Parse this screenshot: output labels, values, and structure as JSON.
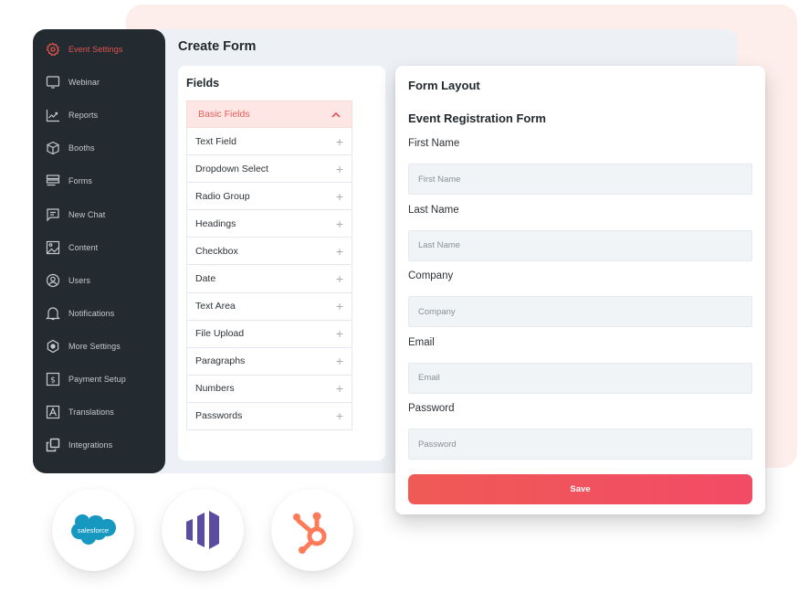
{
  "sidebar": {
    "items": [
      {
        "label": "Event Settings",
        "icon": "gear-icon",
        "active": true
      },
      {
        "label": "Webinar",
        "icon": "monitor-icon"
      },
      {
        "label": "Reports",
        "icon": "chart-icon"
      },
      {
        "label": "Booths",
        "icon": "cube-icon"
      },
      {
        "label": "Forms",
        "icon": "forms-icon"
      },
      {
        "label": "New Chat",
        "icon": "chat-icon"
      },
      {
        "label": "Content",
        "icon": "image-icon"
      },
      {
        "label": "Users",
        "icon": "user-icon"
      },
      {
        "label": "Notifications",
        "icon": "bell-icon"
      },
      {
        "label": "More Settings",
        "icon": "hexagon-settings-icon"
      },
      {
        "label": "Payment Setup",
        "icon": "dollar-icon"
      },
      {
        "label": "Translations",
        "icon": "translate-icon"
      },
      {
        "label": "Integrations",
        "icon": "integrations-icon"
      }
    ]
  },
  "header": {
    "title": "Create Form"
  },
  "fields": {
    "title": "Fields",
    "section": "Basic Fields",
    "items": [
      "Text Field",
      "Dropdown Select",
      "Radio Group",
      "Headings",
      "Checkbox",
      "Date",
      "Text Area",
      "File Upload",
      "Paragraphs",
      "Numbers",
      "Passwords"
    ]
  },
  "layout": {
    "title": "Form Layout",
    "form_title": "Event Registration Form",
    "inputs": [
      {
        "label": "First Name",
        "placeholder": "First Name"
      },
      {
        "label": "Last Name",
        "placeholder": "Last Name"
      },
      {
        "label": "Company",
        "placeholder": "Company"
      },
      {
        "label": "Email",
        "placeholder": "Email"
      },
      {
        "label": "Password",
        "placeholder": "Password"
      }
    ],
    "save_label": "Save"
  },
  "integrations": [
    {
      "name": "Salesforce",
      "label": "salesforce",
      "color": "#1798c1"
    },
    {
      "name": "Marketo",
      "color": "#5c4c9f"
    },
    {
      "name": "HubSpot",
      "color": "#ff7a59"
    }
  ],
  "colors": {
    "accent": "#e2524f",
    "sidebar": "#232b30"
  }
}
